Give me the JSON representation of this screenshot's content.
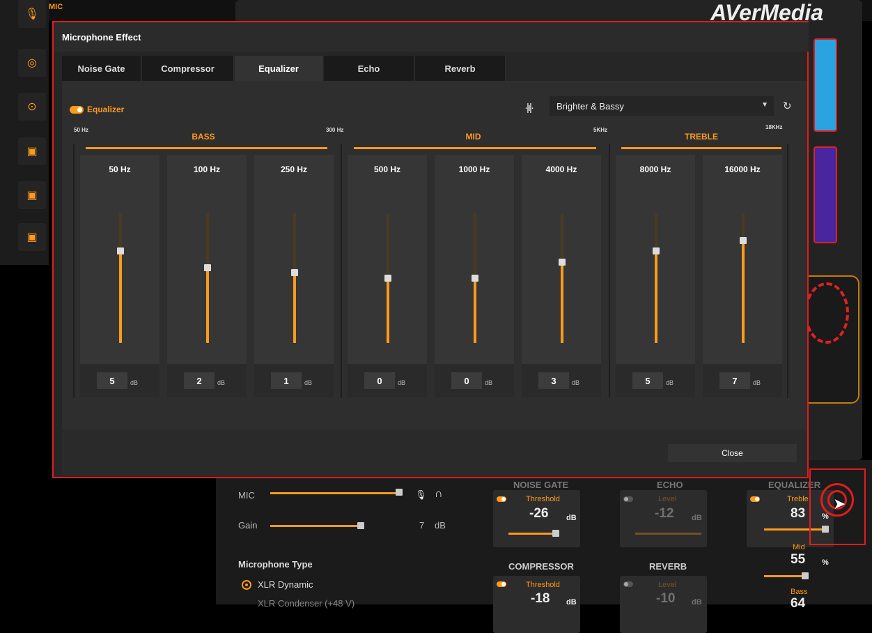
{
  "background": {
    "logo": "AVerMedia",
    "mic_label": "MIC",
    "mixer": {
      "mic_label": "MIC",
      "gain_label": "Gain",
      "gain_value": "7",
      "gain_unit": "dB",
      "mic_type_title": "Microphone Type",
      "mic_type_selected": "XLR Dynamic",
      "mic_type_next": "XLR Condenser (+48 V)"
    },
    "effects": {
      "noise_gate": {
        "title": "NOISE GATE",
        "sub": "Threshold",
        "value": "-26",
        "unit": "dB"
      },
      "echo": {
        "title": "ECHO",
        "sub": "Level",
        "value": "-12",
        "unit": "dB"
      },
      "equalizer": {
        "title": "EQUALIZER",
        "treble_label": "Treble",
        "treble_value": "83",
        "mid_label": "Mid",
        "mid_value": "55",
        "bass_label": "Bass",
        "bass_value": "64",
        "unit": "%"
      },
      "compressor": {
        "title": "COMPRESSOR",
        "sub": "Threshold",
        "value": "-18",
        "unit": "dB"
      },
      "reverb": {
        "title": "REVERB",
        "sub": "Level",
        "value": "-10",
        "unit": "dB"
      }
    }
  },
  "dialog": {
    "title": "Microphone Effect",
    "tabs": [
      "Noise Gate",
      "Compressor",
      "Equalizer",
      "Echo",
      "Reverb"
    ],
    "active_tab": "Equalizer",
    "equalizer_toggle_label": "Equalizer",
    "preset": "Brighter & Bassy",
    "freq_marks": [
      "50 Hz",
      "300 Hz",
      "5KHz",
      "18KHz"
    ],
    "bands": [
      "BASS",
      "MID",
      "TREBLE"
    ],
    "eq_unit": "dB",
    "eq_bands": [
      {
        "label": "50 Hz",
        "value": "5"
      },
      {
        "label": "100 Hz",
        "value": "2"
      },
      {
        "label": "250 Hz",
        "value": "1"
      },
      {
        "label": "500 Hz",
        "value": "0"
      },
      {
        "label": "1000 Hz",
        "value": "0"
      },
      {
        "label": "4000 Hz",
        "value": "3"
      },
      {
        "label": "8000 Hz",
        "value": "5"
      },
      {
        "label": "16000 Hz",
        "value": "7"
      }
    ],
    "close_label": "Close"
  },
  "colors": {
    "accent": "#ff9a1a",
    "highlight": "#e31c1c"
  }
}
